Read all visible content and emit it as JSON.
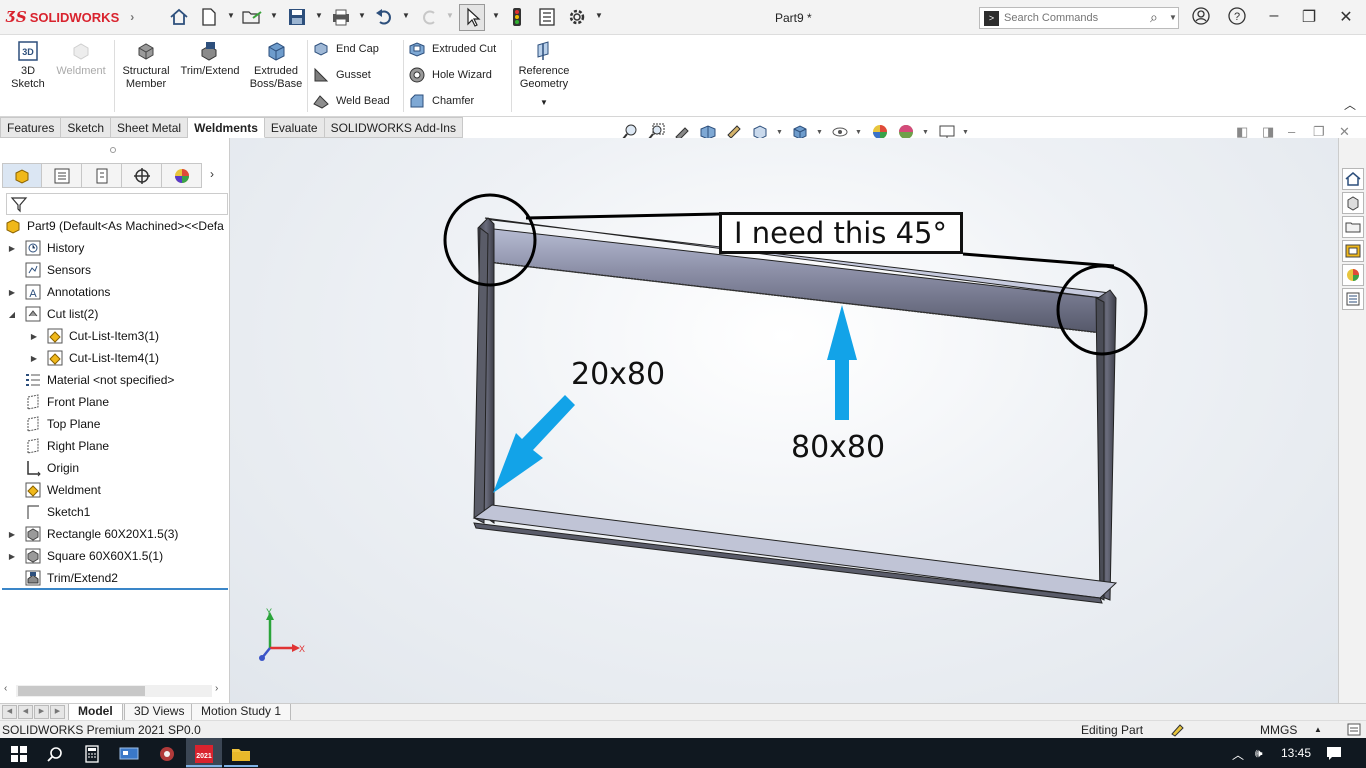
{
  "app": {
    "brand": "SOLIDWORKS",
    "document_title": "Part9 *",
    "search_placeholder": "Search Commands"
  },
  "command_manager": {
    "sketch3d_label": "3D\nSketch",
    "weldment_label": "Weldment",
    "structural_member_label": "Structural\nMember",
    "trim_extend_label": "Trim/Extend",
    "extruded_boss_label": "Extruded\nBoss/Base",
    "end_cap_label": "End Cap",
    "gusset_label": "Gusset",
    "weld_bead_label": "Weld Bead",
    "extruded_cut_label": "Extruded Cut",
    "hole_wizard_label": "Hole Wizard",
    "chamfer_label": "Chamfer",
    "reference_geometry_label": "Reference\nGeometry"
  },
  "tabs": [
    {
      "label": "Features"
    },
    {
      "label": "Sketch"
    },
    {
      "label": "Sheet Metal"
    },
    {
      "label": "Weldments"
    },
    {
      "label": "Evaluate"
    },
    {
      "label": "SOLIDWORKS Add-Ins"
    }
  ],
  "feature_tree": {
    "root": "Part9  (Default<As Machined><<Defa",
    "items": [
      {
        "label": "History"
      },
      {
        "label": "Sensors"
      },
      {
        "label": "Annotations"
      },
      {
        "label": "Cut list(2)"
      },
      {
        "label": "Cut-List-Item3(1)"
      },
      {
        "label": "Cut-List-Item4(1)"
      },
      {
        "label": "Material <not specified>"
      },
      {
        "label": "Front Plane"
      },
      {
        "label": "Top Plane"
      },
      {
        "label": "Right Plane"
      },
      {
        "label": "Origin"
      },
      {
        "label": "Weldment"
      },
      {
        "label": "Sketch1"
      },
      {
        "label": "Rectangle 60X20X1.5(3)"
      },
      {
        "label": "Square 60X60X1.5(1)"
      },
      {
        "label": "Trim/Extend2"
      }
    ]
  },
  "annotations": {
    "note_45": "I need this 45°",
    "label_20x80": "20x80",
    "label_80x80": "80x80",
    "triad_x": "X",
    "triad_y": "Y",
    "arrow_color": "#12a3e8"
  },
  "bottom_tabs": [
    {
      "label": "Model"
    },
    {
      "label": "3D Views"
    },
    {
      "label": "Motion Study 1"
    }
  ],
  "status_bar": {
    "product": "SOLIDWORKS Premium 2021 SP0.0",
    "mode": "Editing Part",
    "units": "MMGS"
  },
  "taskbar": {
    "clock": "13:45",
    "sw_badge": "2021"
  }
}
